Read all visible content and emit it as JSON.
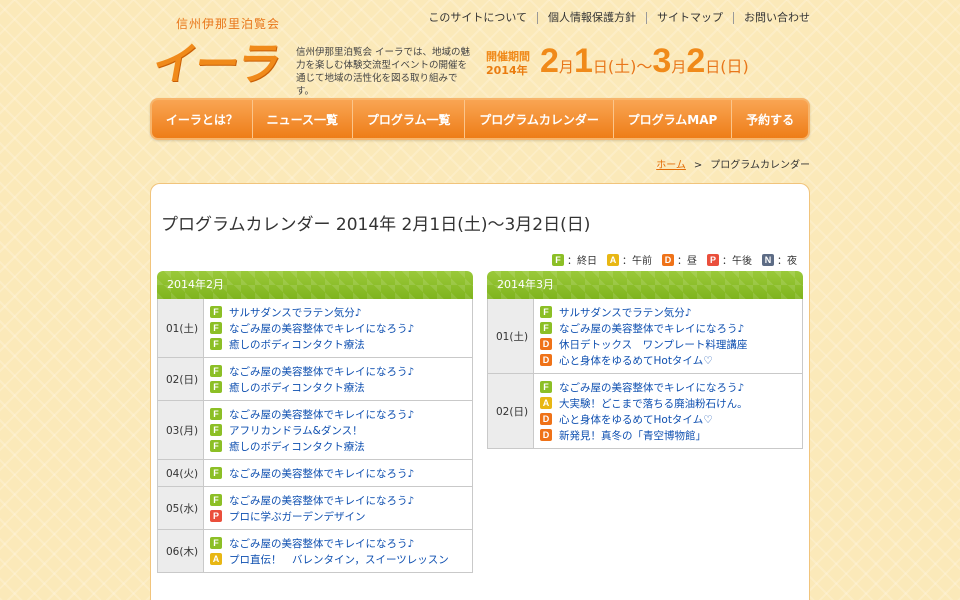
{
  "header": {
    "brand_small": "信州伊那里泊覧会",
    "logo_text": "イーラ",
    "intro": "信州伊那里泊覧会 イーラでは、地域の魅力を楽しむ体験交流型イベントの開催を通じて地域の活性化を図る取り組みです。",
    "period_label": "開催期間",
    "period_year": "2014",
    "period_year_suffix": "年",
    "period": {
      "m1": "2",
      "m1u": "月",
      "d1": "1",
      "d1u": "日",
      "w1": "(土)",
      "tilde": "～",
      "m2": "3",
      "m2u": "月",
      "d2": "2",
      "d2u": "日",
      "w2": "(日)"
    },
    "top_links": [
      "このサイトについて",
      "個人情報保護方針",
      "サイトマップ",
      "お問い合わせ"
    ]
  },
  "nav": [
    "イーラとは？",
    "ニュース一覧",
    "プログラム一覧",
    "プログラムカレンダー",
    "プログラムMAP",
    "予約する"
  ],
  "breadcrumb": {
    "home": "ホーム",
    "sep": ">",
    "current": "プログラムカレンダー"
  },
  "page_title": "プログラムカレンダー 2014年 2月1日(土)～3月2日(日)",
  "legend": [
    {
      "code": "F",
      "label": "：終日"
    },
    {
      "code": "A",
      "label": "：午前"
    },
    {
      "code": "D",
      "label": "：昼"
    },
    {
      "code": "P",
      "label": "：午後"
    },
    {
      "code": "N",
      "label": "：夜"
    }
  ],
  "months": [
    {
      "title": "2014年2月",
      "days": [
        {
          "date": "01(土)",
          "events": [
            {
              "code": "F",
              "title": "サルサダンスでラテン気分♪"
            },
            {
              "code": "F",
              "title": "なごみ屋の美容整体でキレイになろう♪"
            },
            {
              "code": "F",
              "title": "癒しのボディコンタクト療法"
            }
          ]
        },
        {
          "date": "02(日)",
          "events": [
            {
              "code": "F",
              "title": "なごみ屋の美容整体でキレイになろう♪"
            },
            {
              "code": "F",
              "title": "癒しのボディコンタクト療法"
            }
          ]
        },
        {
          "date": "03(月)",
          "events": [
            {
              "code": "F",
              "title": "なごみ屋の美容整体でキレイになろう♪"
            },
            {
              "code": "F",
              "title": "アフリカンドラム&ダンス！"
            },
            {
              "code": "F",
              "title": "癒しのボディコンタクト療法"
            }
          ]
        },
        {
          "date": "04(火)",
          "events": [
            {
              "code": "F",
              "title": "なごみ屋の美容整体でキレイになろう♪"
            }
          ]
        },
        {
          "date": "05(水)",
          "events": [
            {
              "code": "F",
              "title": "なごみ屋の美容整体でキレイになろう♪"
            },
            {
              "code": "P",
              "title": "プロに学ぶガーデンデザイン"
            }
          ]
        },
        {
          "date": "06(木)",
          "events": [
            {
              "code": "F",
              "title": "なごみ屋の美容整体でキレイになろう♪"
            },
            {
              "code": "A",
              "title": "プロ直伝！　バレンタイン，スイーツレッスン"
            }
          ]
        }
      ]
    },
    {
      "title": "2014年3月",
      "days": [
        {
          "date": "01(土)",
          "events": [
            {
              "code": "F",
              "title": "サルサダンスでラテン気分♪"
            },
            {
              "code": "F",
              "title": "なごみ屋の美容整体でキレイになろう♪"
            },
            {
              "code": "D",
              "title": "休日デトックス　ワンプレート料理講座"
            },
            {
              "code": "D",
              "title": "心と身体をゆるめてHotタイム♡"
            }
          ]
        },
        {
          "date": "02(日)",
          "events": [
            {
              "code": "F",
              "title": "なごみ屋の美容整体でキレイになろう♪"
            },
            {
              "code": "A",
              "title": "大実験！どこまで落ちる廃油粉石けん。"
            },
            {
              "code": "D",
              "title": "心と身体をゆるめてHotタイム♡"
            },
            {
              "code": "D",
              "title": "新発見！真冬の「青空博物館」"
            }
          ]
        }
      ]
    }
  ]
}
